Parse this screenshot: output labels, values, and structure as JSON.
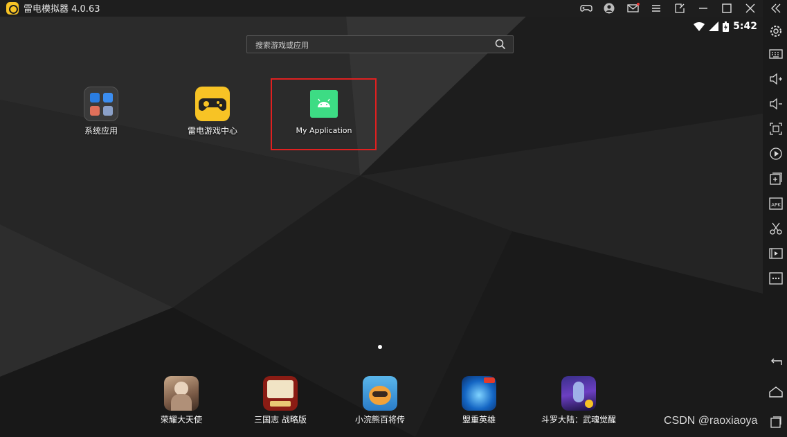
{
  "window": {
    "title": "雷电模拟器 4.0.63",
    "controls": [
      "gamepad-icon",
      "account-icon",
      "mail-icon",
      "menu-icon",
      "minimize-icon",
      "maximize-icon",
      "close-icon",
      "collapse-icon"
    ]
  },
  "status_bar": {
    "time": "5:42"
  },
  "search": {
    "placeholder": "搜索游戏或应用"
  },
  "desktop_apps": [
    {
      "label": "系统应用"
    },
    {
      "label": "雷电游戏中心"
    },
    {
      "label": "My Application"
    }
  ],
  "dock_apps": [
    {
      "label": "荣耀大天使"
    },
    {
      "label": "三国志 战略版"
    },
    {
      "label": "小浣熊百将传"
    },
    {
      "label": "盟重英雄"
    },
    {
      "label": "斗罗大陆：武魂觉醒"
    }
  ],
  "sidebar_tools": [
    "settings-icon",
    "keyboard-icon",
    "volume-up-icon",
    "volume-down-icon",
    "fullscreen-icon",
    "record-icon",
    "add-window-icon",
    "apk-icon",
    "screenshot-icon",
    "video-icon",
    "more-icon",
    "back-icon",
    "home-icon",
    "recent-apps-icon"
  ],
  "watermark": "CSDN @raoxiaoya",
  "colors": {
    "accent": "#f7c325",
    "highlight": "#e02020",
    "android_green": "#3ddc84"
  }
}
